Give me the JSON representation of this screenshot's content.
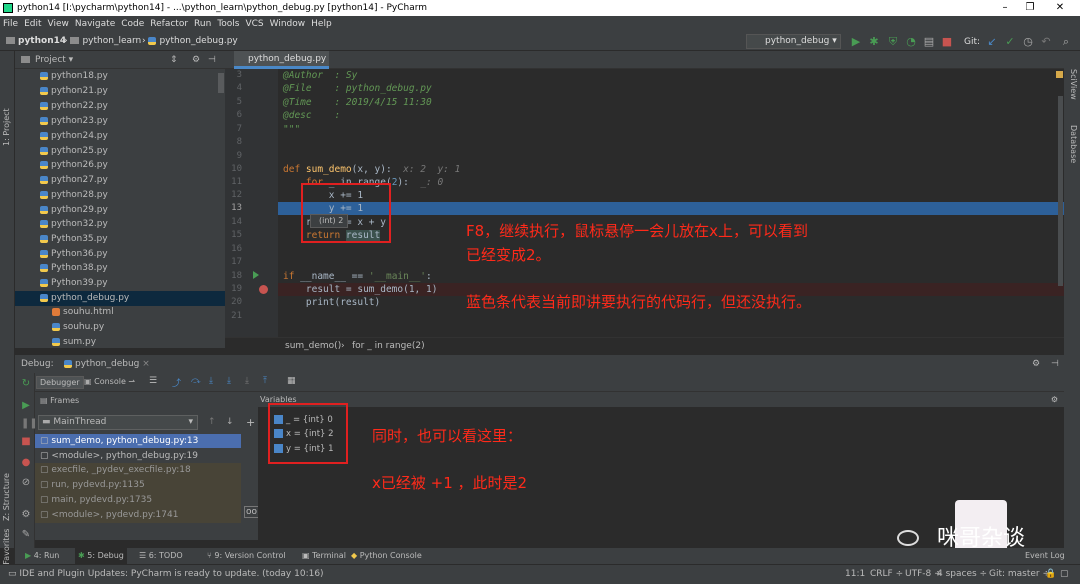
{
  "window": {
    "title": "python14 [I:\\pycharm\\python14] - ...\\python_learn\\python_debug.py [python14] - PyCharm"
  },
  "menu": [
    "File",
    "Edit",
    "View",
    "Navigate",
    "Code",
    "Refactor",
    "Run",
    "Tools",
    "VCS",
    "Window",
    "Help"
  ],
  "breadcrumb": {
    "project": "python14",
    "folder": "python_learn",
    "file": "python_debug.py"
  },
  "run_config": "python_debug",
  "git_label": "Git:",
  "project_panel": {
    "title": "Project",
    "files": [
      "python18.py",
      "python21.py",
      "python22.py",
      "python23.py",
      "python24.py",
      "python25.py",
      "python26.py",
      "python27.py",
      "python28.py",
      "python29.py",
      "python32.py",
      "Python35.py",
      "Python36.py",
      "Python38.py",
      "Python39.py",
      "python_debug.py",
      "souhu.html",
      "souhu.py",
      "sum.py"
    ],
    "selected": "python_debug.py"
  },
  "side_labels": {
    "project": "1: Project",
    "structure": "Z: Structure",
    "favorites": "2: Favorites",
    "sciview": "SciView",
    "database": "Database"
  },
  "editor": {
    "tab": "python_debug.py",
    "line_numbers": [
      "3",
      "4",
      "5",
      "6",
      "7",
      "8",
      "9",
      "10",
      "11",
      "12",
      "13",
      "14",
      "15",
      "16",
      "17",
      "18",
      "19",
      "20",
      "21"
    ],
    "lines": {
      "l3a": "@Author  : ",
      "l3b": "Sy",
      "l4a": "@File    : ",
      "l4b": "python_debug.py",
      "l5a": "@Time    : ",
      "l5b": "2019/4/15 11:30",
      "l6a": "@desc    :",
      "l7": "\"\"\"",
      "l10_def": "def ",
      "l10_fn": "sum_demo",
      "l10_args": "(x, y):",
      "l10_hint": "  x: 2  y: 1",
      "l11_for": "    for ",
      "l11_mid": "_ in range(",
      "l11_num": "2",
      "l11_end": "):",
      "l11_hint": "  _: 0",
      "l12": "        x += 1",
      "l13": "        y += 1",
      "l14": "    result = x + y",
      "l15_kw": "    return ",
      "l15_var": "result",
      "l18_kw": "if ",
      "l18_mid": "__name__ == ",
      "l18_str": "'__main__'",
      "l18_end": ":",
      "l19": "    result = sum_demo(1, 1)",
      "l20": "    print(result)"
    },
    "tooltip": "(int) 2",
    "breadcrumb": [
      "sum_demo()",
      "for _ in range(2)"
    ]
  },
  "annotations": {
    "a1_line1": "F8，继续执行，鼠标悬停一会儿放在x上，可以看到",
    "a1_line2": "已经变成2。",
    "a2": "蓝色条代表当前即讲要执行的代码行，但还没执行。",
    "a3": "同时，也可以看这里：",
    "a4": "x已经被 +1 ，此时是2"
  },
  "debug": {
    "label": "Debug:",
    "config": "python_debug",
    "tabs": {
      "debugger": "Debugger",
      "console": "Console"
    },
    "frames_title": "Frames",
    "variables_title": "Variables",
    "thread": "MainThread",
    "frames": [
      "sum_demo, python_debug.py:13",
      "<module>, python_debug.py:19",
      "execfile, _pydev_execfile.py:18",
      "run, pydevd.py:1135",
      "main, pydevd.py:1735",
      "<module>, pydevd.py:1741"
    ],
    "variables": [
      "_ = {int} 0",
      "x = {int} 2",
      "y = {int} 1"
    ]
  },
  "bottom_tabs": [
    "4: Run",
    "5: Debug",
    "6: TODO",
    "9: Version Control",
    "Terminal",
    "Python Console"
  ],
  "status": {
    "message": "IDE and Plugin Updates: PyCharm is ready to update. (today 10:16)",
    "position": "11:1",
    "line_sep": "CRLF ÷",
    "encoding": "UTF-8 ÷",
    "indent": "4 spaces ÷",
    "git": "Git: master ÷",
    "event_log": "Event Log"
  },
  "watermark": {
    "text": "咪哥杂谈"
  }
}
